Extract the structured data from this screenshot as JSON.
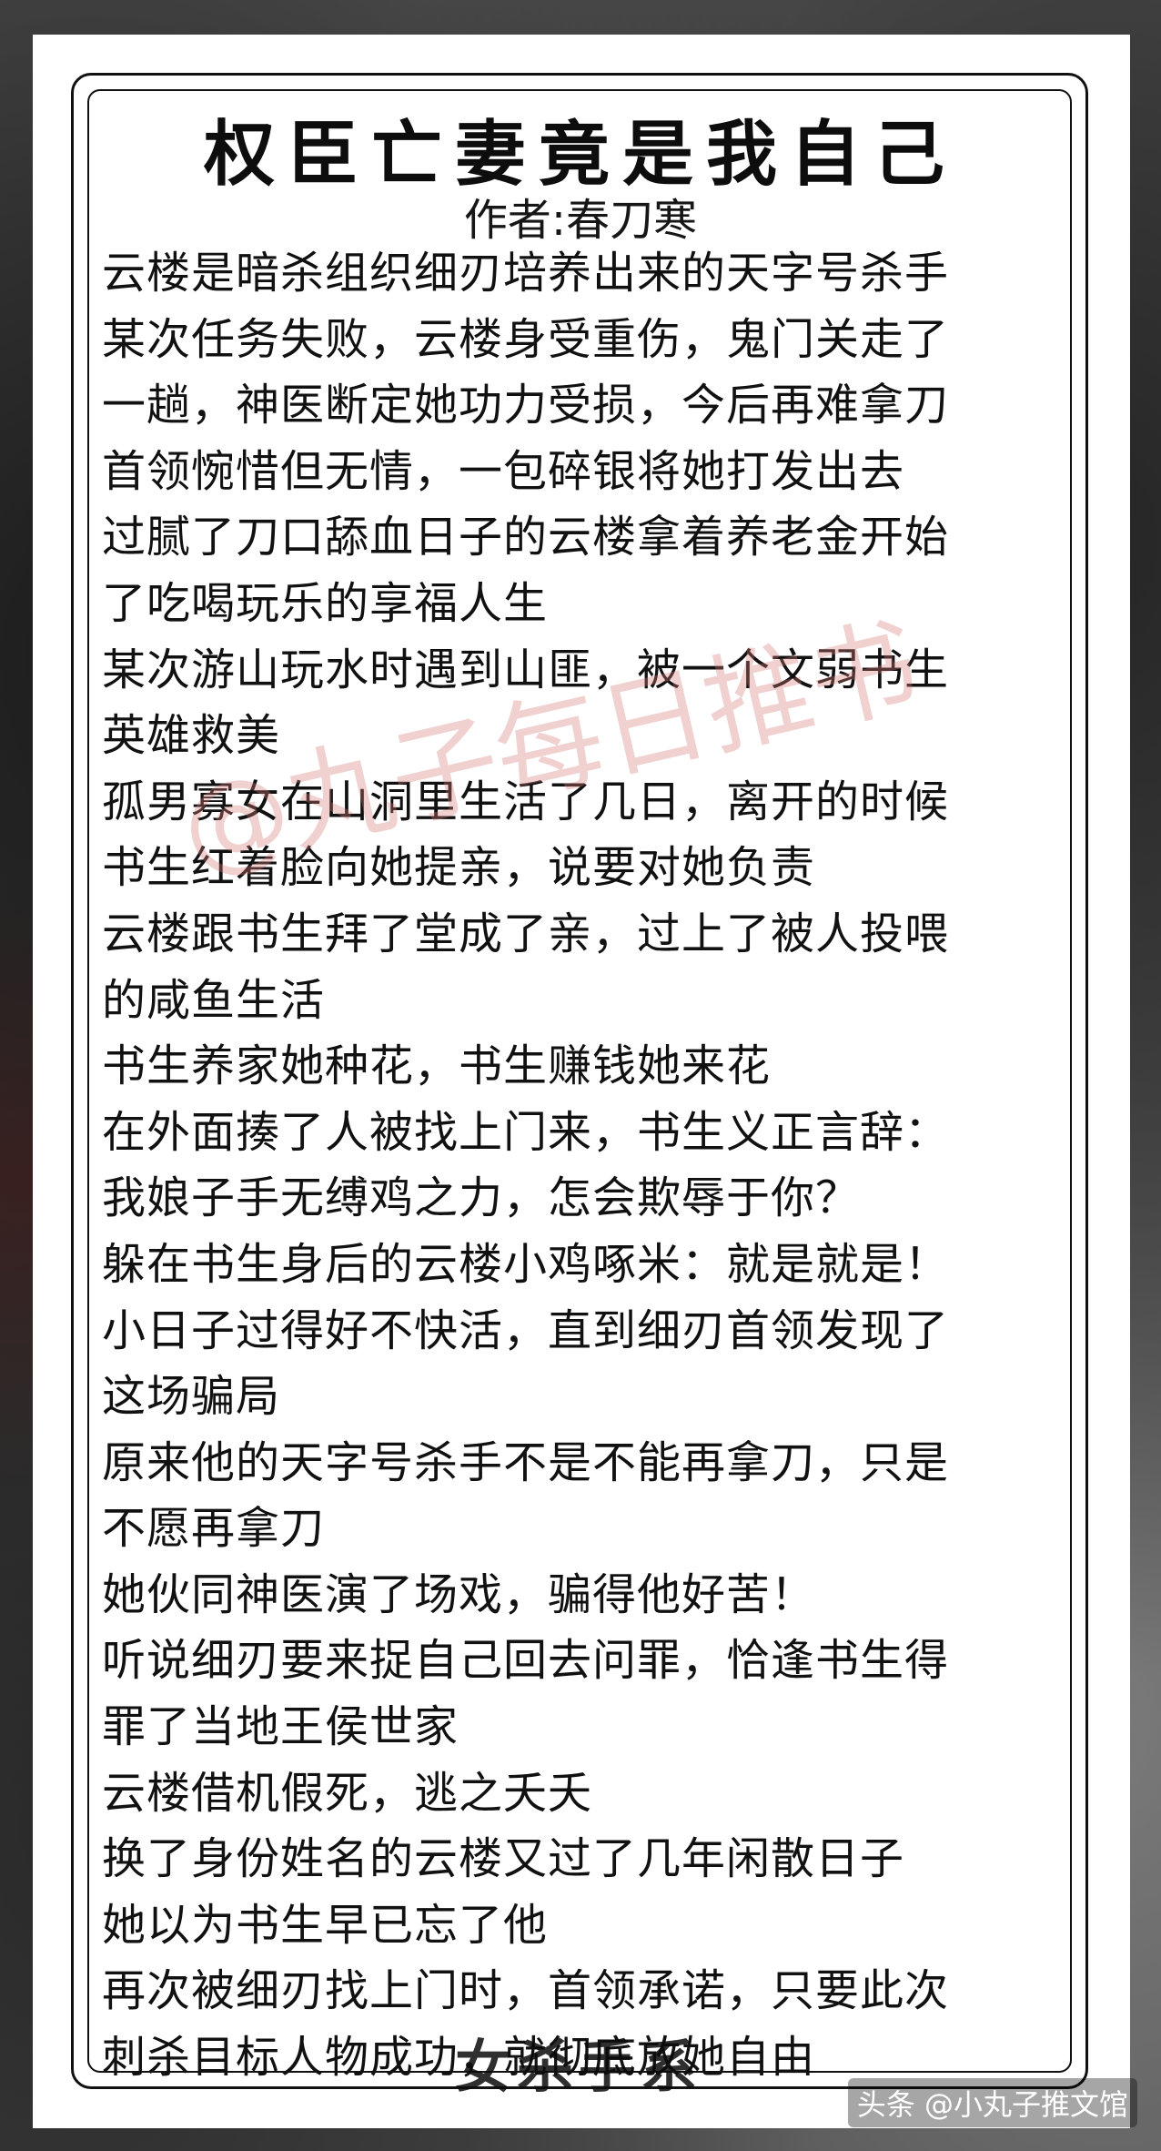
{
  "title": "权臣亡妻竟是我自己",
  "author": "作者:春刀寒",
  "lines": [
    "云楼是暗杀组织细刃培养出来的天字号杀手",
    "某次任务失败，云楼身受重伤，鬼门关走了",
    "一趟，神医断定她功力受损，今后再难拿刀",
    "首领惋惜但无情，一包碎银将她打发出去",
    "过腻了刀口舔血日子的云楼拿着养老金开始",
    "了吃喝玩乐的享福人生",
    "某次游山玩水时遇到山匪，被一个文弱书生",
    "英雄救美",
    "孤男寡女在山洞里生活了几日，离开的时候",
    "书生红着脸向她提亲，说要对她负责",
    "云楼跟书生拜了堂成了亲，过上了被人投喂",
    "的咸鱼生活",
    "书生养家她种花，书生赚钱她来花",
    "在外面揍了人被找上门来，书生义正言辞：",
    "我娘子手无缚鸡之力，怎会欺辱于你？",
    "躲在书生身后的云楼小鸡啄米：就是就是！",
    "小日子过得好不快活，直到细刃首领发现了",
    "这场骗局",
    "原来他的天字号杀手不是不能再拿刀，只是",
    "不愿再拿刀",
    "她伙同神医演了场戏，骗得他好苦！",
    "听说细刃要来捉自己回去问罪，恰逢书生得",
    "罪了当地王侯世家",
    "云楼借机假死，逃之夭夭",
    "换了身份姓名的云楼又过了几年闲散日子",
    "她以为书生早已忘了他",
    "再次被细刃找上门时，首领承诺，只要此次",
    "刺杀目标人物成功，就彻底放她自由"
  ],
  "watermark": "@丸子每日推书",
  "stamp": "女杀手系",
  "credit": "头条 @小丸子推文馆"
}
